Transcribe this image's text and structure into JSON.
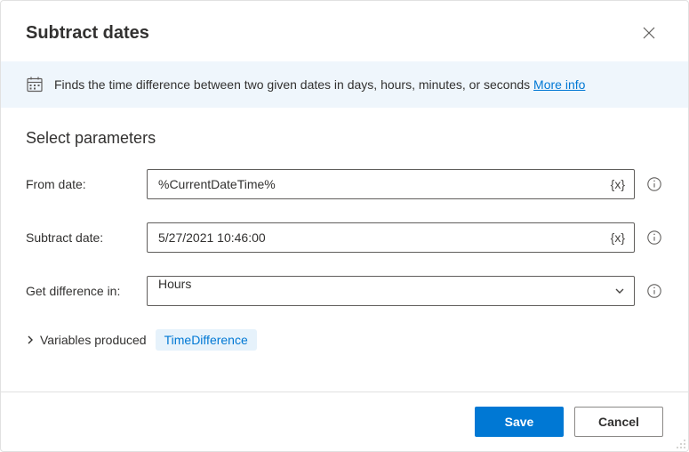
{
  "dialog": {
    "title": "Subtract dates"
  },
  "info": {
    "text": "Finds the time difference between two given dates in days, hours, minutes, or seconds",
    "link": "More info"
  },
  "section": {
    "title": "Select parameters"
  },
  "fields": {
    "from_date": {
      "label": "From date:",
      "value": "%CurrentDateTime%",
      "suffix": "{x}"
    },
    "subtract_date": {
      "label": "Subtract date:",
      "value": "5/27/2021 10:46:00",
      "suffix": "{x}"
    },
    "difference": {
      "label": "Get difference in:",
      "value": "Hours"
    }
  },
  "variables": {
    "label": "Variables produced",
    "chip": "TimeDifference"
  },
  "footer": {
    "save": "Save",
    "cancel": "Cancel"
  }
}
